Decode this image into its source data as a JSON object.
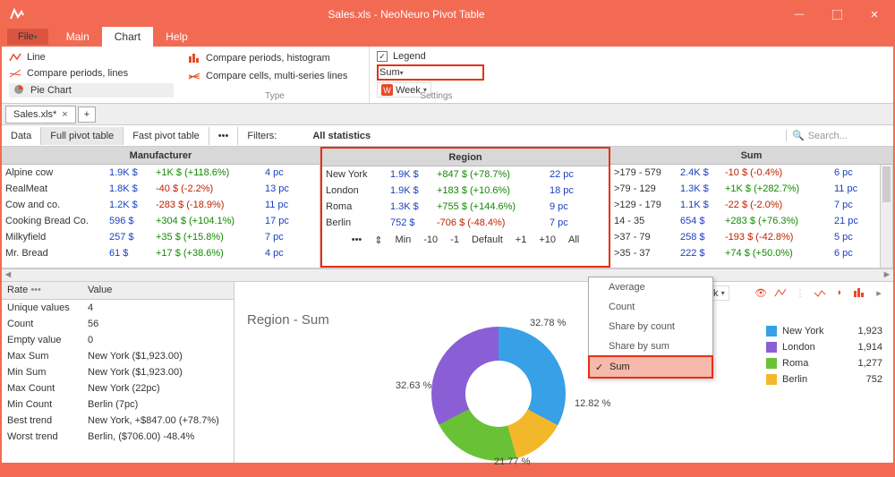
{
  "win": {
    "title": "Sales.xls - NeoNeuro Pivot Table"
  },
  "menu": {
    "file": "File",
    "main": "Main",
    "chart": "Chart",
    "help": "Help"
  },
  "ribbon": {
    "type": {
      "line": "Line",
      "cpl": "Compare periods, lines",
      "pie": "Pie Chart",
      "cph": "Compare periods, histogram",
      "ccl": "Compare cells, multi-series lines",
      "label": "Type"
    },
    "settings": {
      "legend": "Legend",
      "sum": "Sum",
      "week": "Week",
      "label": "Settings"
    }
  },
  "filetab": {
    "name": "Sales.xls*"
  },
  "toolbar": {
    "data": "Data",
    "fpt": "Full pivot table",
    "fast": "Fast pivot table",
    "filters": "Filters:",
    "stat": "All statistics",
    "search": "Search..."
  },
  "cols": {
    "manu": {
      "hdr": "Manufacturer",
      "rows": [
        {
          "n": "Alpine cow",
          "v": "1.9K $",
          "d": "+1K $ (+118.6%)",
          "p": "4 pc",
          "s": "pos"
        },
        {
          "n": "RealMeat",
          "v": "1.8K $",
          "d": "-40 $ (-2.2%)",
          "p": "13 pc",
          "s": "neg"
        },
        {
          "n": "Cow and co.",
          "v": "1.2K $",
          "d": "-283 $ (-18.9%)",
          "p": "11 pc",
          "s": "neg"
        },
        {
          "n": "Cooking Bread Co.",
          "v": "596 $",
          "d": "+304 $ (+104.1%)",
          "p": "17 pc",
          "s": "pos"
        },
        {
          "n": "Milkyfield",
          "v": "257 $",
          "d": "+35 $ (+15.8%)",
          "p": "7 pc",
          "s": "pos"
        },
        {
          "n": "Mr. Bread",
          "v": "61 $",
          "d": "+17 $ (+38.6%)",
          "p": "4 pc",
          "s": "pos"
        }
      ]
    },
    "region": {
      "hdr": "Region",
      "rows": [
        {
          "n": "New York",
          "v": "1.9K $",
          "d": "+847 $ (+78.7%)",
          "p": "22 pc",
          "s": "pos"
        },
        {
          "n": "London",
          "v": "1.9K $",
          "d": "+183 $ (+10.6%)",
          "p": "18 pc",
          "s": "pos"
        },
        {
          "n": "Roma",
          "v": "1.3K $",
          "d": "+755 $ (+144.6%)",
          "p": "9 pc",
          "s": "pos"
        },
        {
          "n": "Berlin",
          "v": "752 $",
          "d": "-706 $ (-48.4%)",
          "p": "7 pc",
          "s": "neg"
        }
      ],
      "slider": {
        "min": "Min",
        "m10": "-10",
        "m1": "-1",
        "def": "Default",
        "p1": "+1",
        "p10": "+10",
        "all": "All"
      }
    },
    "sum": {
      "hdr": "Sum",
      "rows": [
        {
          "n": ">179 - 579",
          "v": "2.4K $",
          "d": "-10 $ (-0.4%)",
          "p": "6 pc",
          "s": "neg"
        },
        {
          "n": ">79 - 129",
          "v": "1.3K $",
          "d": "+1K $ (+282.7%)",
          "p": "11 pc",
          "s": "pos"
        },
        {
          "n": ">129 - 179",
          "v": "1.1K $",
          "d": "-22 $ (-2.0%)",
          "p": "7 pc",
          "s": "neg"
        },
        {
          "n": "14 - 35",
          "v": "654 $",
          "d": "+283 $ (+76.3%)",
          "p": "21 pc",
          "s": "pos"
        },
        {
          "n": ">37 - 79",
          "v": "258 $",
          "d": "-193 $ (-42.8%)",
          "p": "5 pc",
          "s": "neg"
        },
        {
          "n": ">35 - 37",
          "v": "222 $",
          "d": "+74 $ (+50.0%)",
          "p": "6 pc",
          "s": "pos"
        }
      ]
    }
  },
  "stats": {
    "rate": "Rate",
    "value": "Value",
    "rows": [
      {
        "k": "Unique values",
        "v": "4"
      },
      {
        "k": "Count",
        "v": "56"
      },
      {
        "k": "Empty value",
        "v": "0"
      },
      {
        "k": "Max Sum",
        "v": "New York ($1,923.00)"
      },
      {
        "k": "Min Sum",
        "v": "New York ($1,923.00)"
      },
      {
        "k": "Max Count",
        "v": "New York (22pc)"
      },
      {
        "k": "Min Count",
        "v": " Berlin (7pc)"
      },
      {
        "k": "Best trend",
        "v": "New York, +$847.00 (+78.7%)"
      },
      {
        "k": "Worst trend",
        "v": " Berlin, ($706.00) -48.4%"
      }
    ]
  },
  "chart": {
    "title": "Region - Sum",
    "sumdd": "Sum",
    "week": "Week",
    "menu": {
      "avg": "Average",
      "cnt": "Count",
      "sbc": "Share by count",
      "sbs": "Share by sum",
      "sum": "Sum"
    },
    "pct": {
      "ny": "32.78 %",
      "br": "12.82 %",
      "rm": "21.77 %",
      "ln": "32.63 %"
    },
    "legend": [
      {
        "n": "New York",
        "v": "1,923",
        "c": "#37a0e6"
      },
      {
        "n": "London",
        "v": "1,914",
        "c": "#8a5fd6"
      },
      {
        "n": "Roma",
        "v": "1,277",
        "c": "#69c236"
      },
      {
        "n": "Berlin",
        "v": "752",
        "c": "#f3b82a"
      }
    ]
  },
  "chart_data": {
    "type": "pie",
    "title": "Region - Sum",
    "categories": [
      "New York",
      "London",
      "Roma",
      "Berlin"
    ],
    "values": [
      1923,
      1914,
      1277,
      752
    ],
    "percentages": [
      32.78,
      32.63,
      21.77,
      12.82
    ],
    "colors": [
      "#37a0e6",
      "#8a5fd6",
      "#69c236",
      "#f3b82a"
    ]
  }
}
